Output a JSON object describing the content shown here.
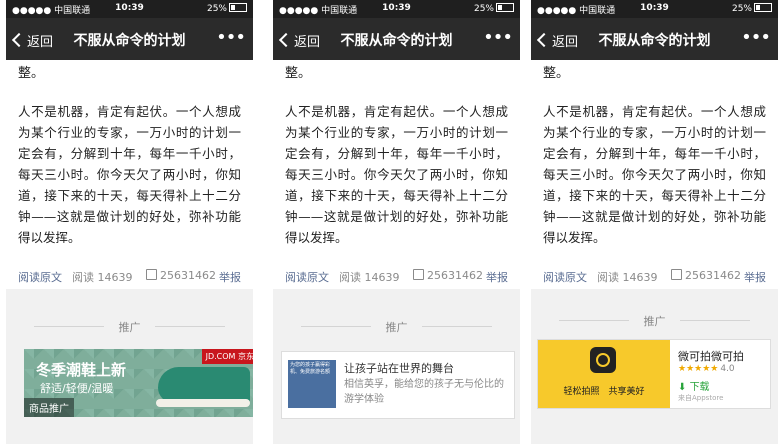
{
  "status": {
    "carrier": "●●●●● 中国联通",
    "time": "10:39",
    "battery": "25%"
  },
  "nav": {
    "back": "返回",
    "title": "不服从命令的计划",
    "more": "•••"
  },
  "article": {
    "first": "整。",
    "body": "人不是机器，肯定有起伏。一个人想成为某个行业的专家，一万小时的计划一定会有，分解到十年，每年一千小时，每天三小时。你今天欠了两小时，你知道，接下来的十天，每天得补上十二分钟——这就是做计划的好处，弥补功能得以发挥。"
  },
  "meta": {
    "read_original": "阅读原文",
    "reads": "阅读 14639",
    "likes": "25631462",
    "report": "举报"
  },
  "ad_label": "推广",
  "ad1": {
    "title": "冬季潮鞋上新",
    "subtitle": "舒适/轻便/温暖",
    "brand": "JD.COM 京东",
    "tag": "商品推广",
    "shoe_color": "#2a8a72"
  },
  "ad2": {
    "title": "让孩子站在世界的舞台",
    "desc": "相信英孚，能给您的孩子无与伦比的游学体验",
    "image_text": "为您的孩子赢得彩机、免费旅游名额"
  },
  "ad3": {
    "name": "微可拍微可拍",
    "slogan": "轻松拍照　共享美好",
    "stars": "★★★★★",
    "rating": "4.0",
    "download": "下载",
    "source": "来自Appstore"
  }
}
